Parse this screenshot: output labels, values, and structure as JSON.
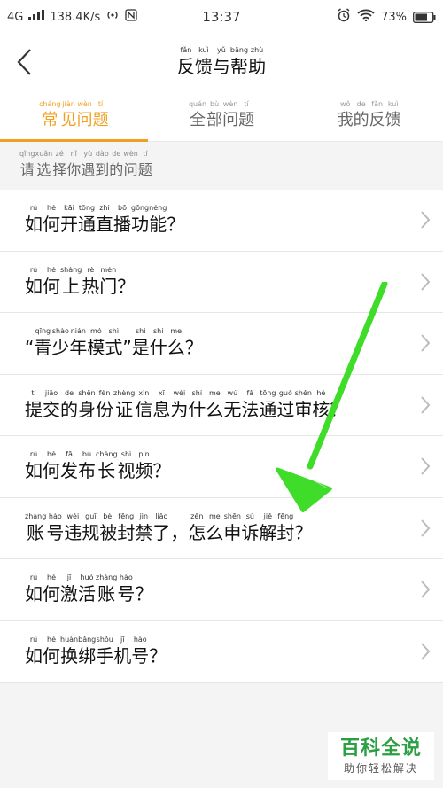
{
  "status": {
    "network": "4G",
    "speed": "138.4K/s",
    "time": "13:37",
    "battery": "73%"
  },
  "header": {
    "title": [
      {
        "py": "fǎn",
        "hz": "反"
      },
      {
        "py": "kuì",
        "hz": "馈"
      },
      {
        "py": "yǔ",
        "hz": "与"
      },
      {
        "py": "bāng",
        "hz": "帮"
      },
      {
        "py": "zhù",
        "hz": "助"
      }
    ]
  },
  "tabs": [
    {
      "active": true,
      "chars": [
        {
          "py": "cháng",
          "hz": "常"
        },
        {
          "py": "jiàn",
          "hz": "见"
        },
        {
          "py": "wèn",
          "hz": "问"
        },
        {
          "py": "tí",
          "hz": "题"
        }
      ]
    },
    {
      "active": false,
      "chars": [
        {
          "py": "quán",
          "hz": "全"
        },
        {
          "py": "bù",
          "hz": "部"
        },
        {
          "py": "wèn",
          "hz": "问"
        },
        {
          "py": "tí",
          "hz": "题"
        }
      ]
    },
    {
      "active": false,
      "chars": [
        {
          "py": "wǒ",
          "hz": "我"
        },
        {
          "py": "de",
          "hz": "的"
        },
        {
          "py": "fǎn",
          "hz": "反"
        },
        {
          "py": "kuì",
          "hz": "馈"
        }
      ]
    }
  ],
  "section_label": [
    {
      "py": "qǐng",
      "hz": "请"
    },
    {
      "py": "xuǎn",
      "hz": "选"
    },
    {
      "py": "zé",
      "hz": "择"
    },
    {
      "py": "nǐ",
      "hz": "你"
    },
    {
      "py": "yù",
      "hz": "遇"
    },
    {
      "py": "dào",
      "hz": "到"
    },
    {
      "py": "de",
      "hz": "的"
    },
    {
      "py": "wèn",
      "hz": "问"
    },
    {
      "py": "tí",
      "hz": "题"
    }
  ],
  "questions": [
    [
      {
        "py": "rú",
        "hz": "如"
      },
      {
        "py": "hé",
        "hz": "何"
      },
      {
        "py": "kāi",
        "hz": "开"
      },
      {
        "py": "tōng",
        "hz": "通"
      },
      {
        "py": "zhí",
        "hz": "直"
      },
      {
        "py": "bō",
        "hz": "播"
      },
      {
        "py": "gōng",
        "hz": "功"
      },
      {
        "py": "néng",
        "hz": "能"
      },
      {
        "py": "",
        "hz": "？"
      }
    ],
    [
      {
        "py": "rú",
        "hz": "如"
      },
      {
        "py": "hé",
        "hz": "何"
      },
      {
        "py": "shàng",
        "hz": "上"
      },
      {
        "py": "rè",
        "hz": "热"
      },
      {
        "py": "mén",
        "hz": "门"
      },
      {
        "py": "",
        "hz": "？"
      }
    ],
    [
      {
        "py": "",
        "hz": "“"
      },
      {
        "py": "qīng",
        "hz": "青"
      },
      {
        "py": "shào",
        "hz": "少"
      },
      {
        "py": "nián",
        "hz": "年"
      },
      {
        "py": "mó",
        "hz": "模"
      },
      {
        "py": "shì",
        "hz": "式"
      },
      {
        "py": "",
        "hz": "”"
      },
      {
        "py": "shì",
        "hz": "是"
      },
      {
        "py": "shí",
        "hz": "什"
      },
      {
        "py": "me",
        "hz": "么"
      },
      {
        "py": "",
        "hz": "？"
      }
    ],
    [
      {
        "py": "tí",
        "hz": "提"
      },
      {
        "py": "jiāo",
        "hz": "交"
      },
      {
        "py": "de",
        "hz": "的"
      },
      {
        "py": "shēn",
        "hz": "身"
      },
      {
        "py": "fèn",
        "hz": "份"
      },
      {
        "py": "zhèng",
        "hz": "证"
      },
      {
        "py": "xìn",
        "hz": "信"
      },
      {
        "py": "xī",
        "hz": "息"
      },
      {
        "py": "wèi",
        "hz": "为"
      },
      {
        "py": "shí",
        "hz": "什"
      },
      {
        "py": "me",
        "hz": "么"
      },
      {
        "py": "wú",
        "hz": "无"
      },
      {
        "py": "fǎ",
        "hz": "法"
      },
      {
        "py": "tōng",
        "hz": "通"
      },
      {
        "py": "guò",
        "hz": "过"
      },
      {
        "py": "shěn",
        "hz": "审"
      },
      {
        "py": "hé",
        "hz": "核"
      },
      {
        "py": "",
        "hz": "？"
      }
    ],
    [
      {
        "py": "rú",
        "hz": "如"
      },
      {
        "py": "hé",
        "hz": "何"
      },
      {
        "py": "fā",
        "hz": "发"
      },
      {
        "py": "bù",
        "hz": "布"
      },
      {
        "py": "cháng",
        "hz": "长"
      },
      {
        "py": "shì",
        "hz": "视"
      },
      {
        "py": "pín",
        "hz": "频"
      },
      {
        "py": "",
        "hz": "？"
      }
    ],
    [
      {
        "py": "zhàng",
        "hz": "账"
      },
      {
        "py": "hào",
        "hz": "号"
      },
      {
        "py": "wéi",
        "hz": "违"
      },
      {
        "py": "guī",
        "hz": "规"
      },
      {
        "py": "bèi",
        "hz": "被"
      },
      {
        "py": "fēng",
        "hz": "封"
      },
      {
        "py": "jìn",
        "hz": "禁"
      },
      {
        "py": "liǎo",
        "hz": "了"
      },
      {
        "py": "",
        "hz": "，"
      },
      {
        "py": "zěn",
        "hz": "怎"
      },
      {
        "py": "me",
        "hz": "么"
      },
      {
        "py": "shēn",
        "hz": "申"
      },
      {
        "py": "sù",
        "hz": "诉"
      },
      {
        "py": "jiě",
        "hz": "解"
      },
      {
        "py": "fēng",
        "hz": "封"
      },
      {
        "py": "",
        "hz": "？"
      }
    ],
    [
      {
        "py": "rú",
        "hz": "如"
      },
      {
        "py": "hé",
        "hz": "何"
      },
      {
        "py": "jī",
        "hz": "激"
      },
      {
        "py": "huó",
        "hz": "活"
      },
      {
        "py": "zhàng",
        "hz": "账"
      },
      {
        "py": "hào",
        "hz": "号"
      },
      {
        "py": "",
        "hz": "？"
      }
    ],
    [
      {
        "py": "rú",
        "hz": "如"
      },
      {
        "py": "hé",
        "hz": "何"
      },
      {
        "py": "huàn",
        "hz": "换"
      },
      {
        "py": "bǎng",
        "hz": "绑"
      },
      {
        "py": "shǒu",
        "hz": "手"
      },
      {
        "py": "jī",
        "hz": "机"
      },
      {
        "py": "hào",
        "hz": "号"
      },
      {
        "py": "",
        "hz": "？"
      }
    ]
  ],
  "watermark": {
    "title": "百科全说",
    "subtitle": "助你轻松解决"
  },
  "colors": {
    "accent": "#f0a020",
    "annotation_arrow": "#3fdc2a",
    "watermark_green": "#2aa043"
  }
}
